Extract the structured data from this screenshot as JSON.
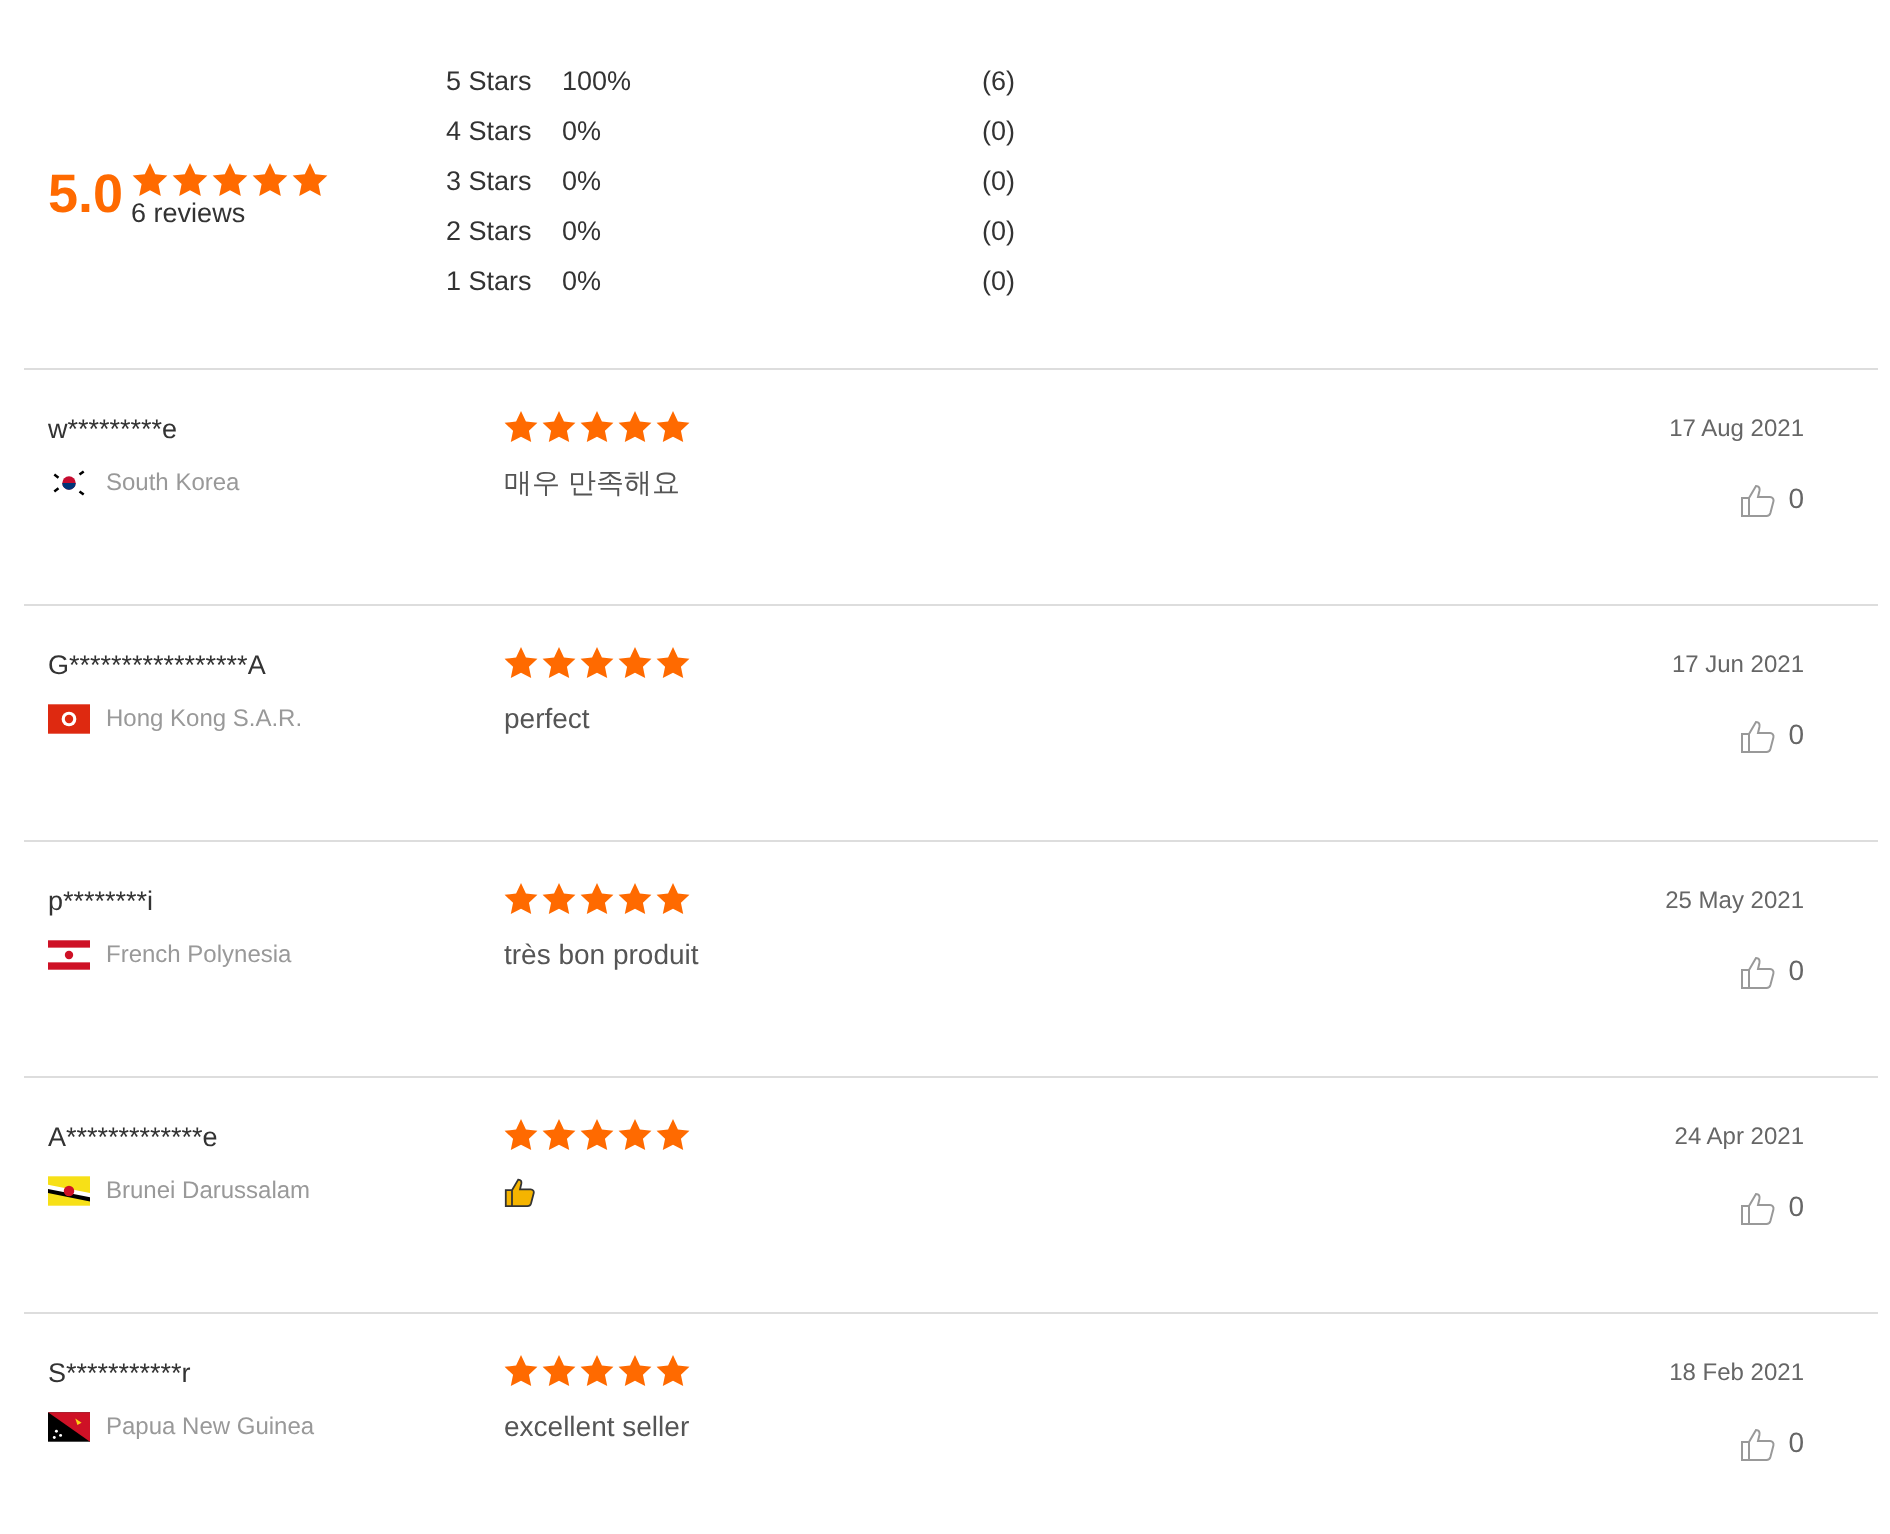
{
  "summary": {
    "rating": "5.0",
    "stars": 5,
    "count": "6 reviews"
  },
  "breakdown": [
    {
      "label": "5 Stars",
      "percent": "100%",
      "count": "(6)"
    },
    {
      "label": "4 Stars",
      "percent": "0%",
      "count": "(0)"
    },
    {
      "label": "3 Stars",
      "percent": "0%",
      "count": "(0)"
    },
    {
      "label": "2 Stars",
      "percent": "0%",
      "count": "(0)"
    },
    {
      "label": "1 Stars",
      "percent": "0%",
      "count": "(0)"
    }
  ],
  "reviews": [
    {
      "name": "w*********e",
      "country": "South Korea",
      "stars": 5,
      "kind": "text",
      "text": "매우 만족해요",
      "date": "17 Aug 2021",
      "likes": "0"
    },
    {
      "name": "G*****************A",
      "country": "Hong Kong S.A.R.",
      "stars": 5,
      "kind": "text",
      "text": "perfect",
      "date": "17 Jun 2021",
      "likes": "0"
    },
    {
      "name": "p********i",
      "country": "French Polynesia",
      "stars": 5,
      "kind": "text",
      "text": "très bon produit",
      "date": "25 May 2021",
      "likes": "0"
    },
    {
      "name": "A*************e",
      "country": "Brunei Darussalam",
      "stars": 5,
      "kind": "thumbs",
      "date": "24 Apr 2021",
      "likes": "0"
    },
    {
      "name": "S***********r",
      "country": "Papua New Guinea",
      "stars": 5,
      "kind": "text",
      "text": "excellent seller",
      "date": "18 Feb 2021",
      "likes": "0"
    }
  ]
}
